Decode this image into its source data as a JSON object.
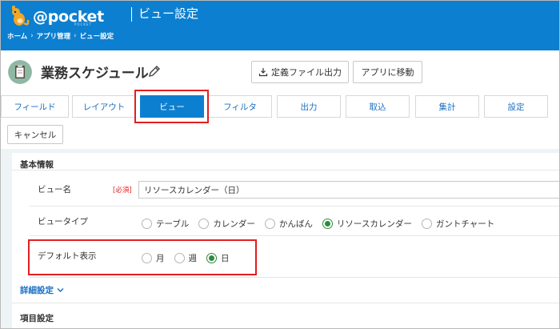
{
  "header": {
    "logo_text": "@pocket",
    "logo_sub": "POCKET",
    "title": "ビュー設定",
    "breadcrumb": [
      "ホーム",
      "アプリ管理",
      "ビュー設定"
    ],
    "color": "#0d7fd0"
  },
  "app": {
    "title": "業務スケジュール",
    "export_label": "定義ファイル出力",
    "move_label": "アプリに移動"
  },
  "tabs": [
    {
      "label": "フィールド"
    },
    {
      "label": "レイアウト"
    },
    {
      "label": "ビュー",
      "active": true
    },
    {
      "label": "フィルタ"
    },
    {
      "label": "出力"
    },
    {
      "label": "取込"
    },
    {
      "label": "集計"
    },
    {
      "label": "設定"
    }
  ],
  "cancel_label": "キャンセル",
  "basic": {
    "title": "基本情報",
    "view_name_label": "ビュー名",
    "required_label": "[必須]",
    "view_name_value": "リソースカレンダー（日）",
    "view_type_label": "ビュータイプ",
    "view_types": [
      "テーブル",
      "カレンダー",
      "かんばん",
      "リソースカレンダー",
      "ガントチャート"
    ],
    "view_type_selected": "リソースカレンダー",
    "default_label": "デフォルト表示",
    "defaults": [
      "月",
      "週",
      "日"
    ],
    "default_selected": "日"
  },
  "details_label": "詳細設定",
  "items_title": "項目設定",
  "colors": {
    "accent": "#0d7fd0",
    "highlight": "#e02020",
    "radio_on": "#2e8b3e",
    "link": "#1a6fc4"
  }
}
